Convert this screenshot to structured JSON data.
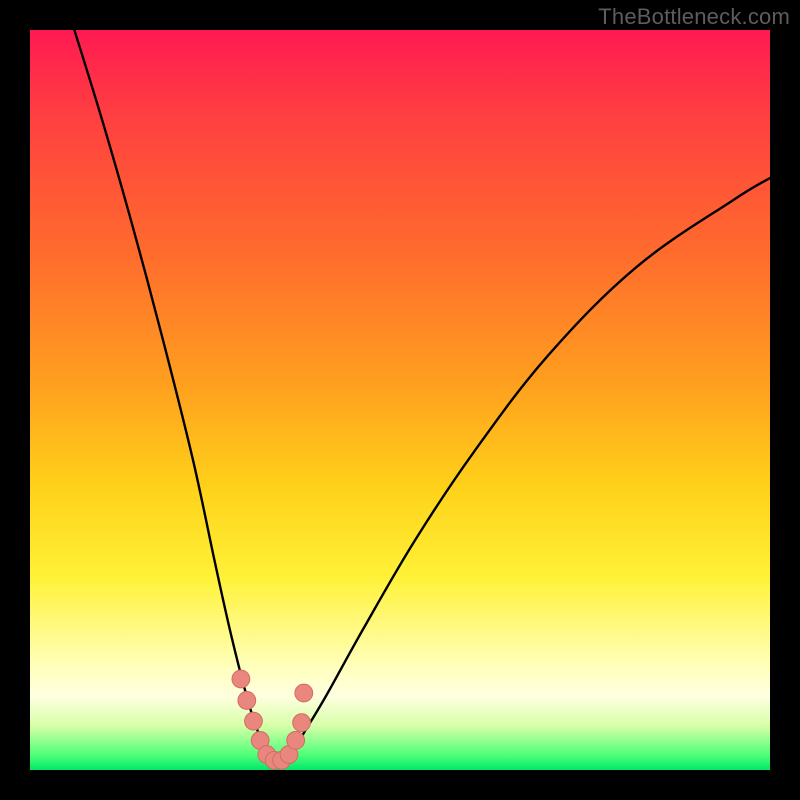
{
  "watermark": "TheBottleneck.com",
  "colors": {
    "frame": "#000000",
    "curve": "#000000",
    "marker_fill": "#e9877f",
    "marker_stroke": "#d46a62"
  },
  "chart_data": {
    "type": "line",
    "title": "",
    "xlabel": "",
    "ylabel": "",
    "xlim": [
      0,
      100
    ],
    "ylim": [
      0,
      100
    ],
    "grid": false,
    "legend": false,
    "note": "Axes are unlabeled in the source image; values below are read off the rendered pixel geometry as percentages of the plot area (0 = left/bottom, 100 = right/top). The black curve is a single V-shaped trace with its minimum near x≈33. Pink circular markers sit on the curve near its minimum.",
    "series": [
      {
        "name": "bottleneck-curve",
        "x": [
          6,
          10,
          14,
          18,
          22,
          25,
          27,
          29,
          30.5,
          32,
          33,
          34,
          35.5,
          37,
          40,
          45,
          52,
          60,
          70,
          82,
          95,
          100
        ],
        "values": [
          100,
          87,
          73,
          58,
          42,
          28,
          19,
          11,
          6,
          2.5,
          1.3,
          1.3,
          2.5,
          5,
          10,
          19,
          31,
          43,
          56,
          68,
          77,
          80
        ]
      }
    ],
    "markers": {
      "name": "highlight-points",
      "x": [
        28.5,
        29.3,
        30.2,
        31.1,
        32.0,
        33.0,
        34.0,
        35.0,
        35.9,
        36.7,
        37.0
      ],
      "values": [
        12.3,
        9.4,
        6.6,
        4.0,
        2.1,
        1.3,
        1.3,
        2.1,
        4.0,
        6.4,
        10.4
      ],
      "radius_pct": 1.2
    }
  }
}
